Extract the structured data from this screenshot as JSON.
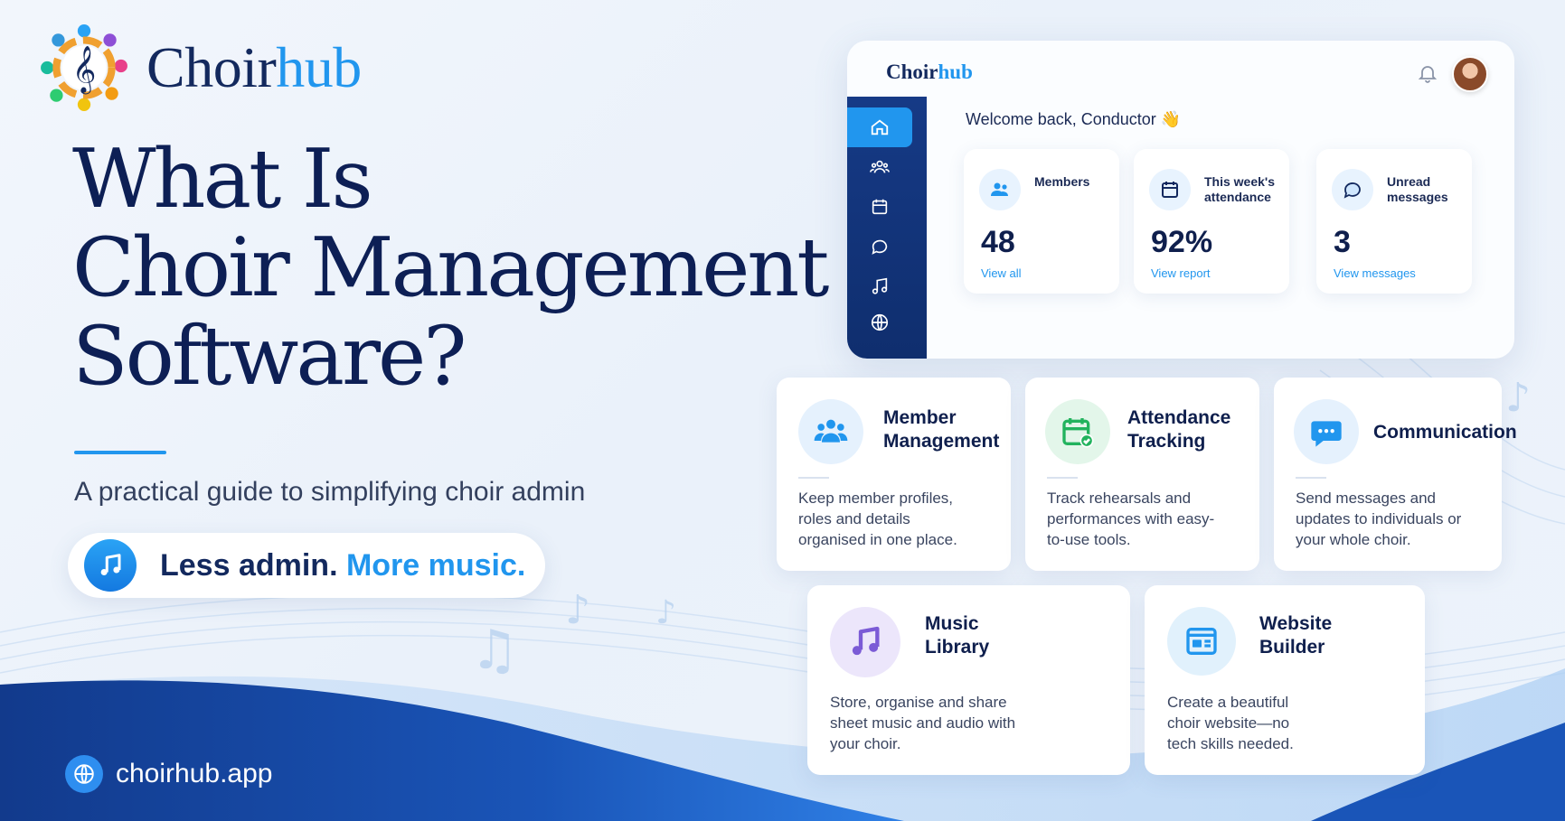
{
  "brand": {
    "name_part1": "Choir",
    "name_part2": "hub"
  },
  "headline": {
    "line1": "What Is",
    "line2": "Choir Management",
    "line3": "Software?"
  },
  "subtitle": "A practical guide to simplifying choir admin",
  "tagline": {
    "part1": "Less admin.",
    "part2": "More music."
  },
  "website": "choirhub.app",
  "dashboard": {
    "logo_part1": "Choir",
    "logo_part2": "hub",
    "welcome": "Welcome back, Conductor 👋",
    "sidebar": [
      {
        "icon": "home-icon",
        "active": true
      },
      {
        "icon": "members-icon",
        "active": false
      },
      {
        "icon": "calendar-icon",
        "active": false
      },
      {
        "icon": "chat-icon",
        "active": false
      },
      {
        "icon": "music-icon",
        "active": false
      },
      {
        "icon": "globe-icon",
        "active": false
      }
    ],
    "stats": [
      {
        "label": "Members",
        "value": "48",
        "link": "View all",
        "icon": "members-icon"
      },
      {
        "label": "This week's attendance",
        "value": "92%",
        "link": "View report",
        "icon": "calendar-icon"
      },
      {
        "label": "Unread messages",
        "value": "3",
        "link": "View messages",
        "icon": "chat-icon"
      }
    ]
  },
  "features": [
    {
      "title": "Member Management",
      "description": "Keep member profiles, roles and details organised in one place.",
      "icon": "people-icon",
      "color": "#2196ee"
    },
    {
      "title": "Attendance Tracking",
      "description": "Track rehearsals and performances with easy-to-use tools.",
      "icon": "calendar-check-icon",
      "color": "#22b35e"
    },
    {
      "title": "Communication",
      "description": "Send messages and updates to individuals or your whole choir.",
      "icon": "chat-bubble-icon",
      "color": "#2196ee"
    },
    {
      "title": "Music Library",
      "description": "Store, organise and share sheet music and audio with your choir.",
      "icon": "music-note-icon",
      "color": "#7b5bd6"
    },
    {
      "title": "Website Builder",
      "description": "Create a beautiful choir website—no tech skills needed.",
      "icon": "website-icon",
      "color": "#2196ee"
    }
  ],
  "colors": {
    "navy": "#0d1f55",
    "accent": "#2196ee",
    "sidebar": "#163a86"
  }
}
